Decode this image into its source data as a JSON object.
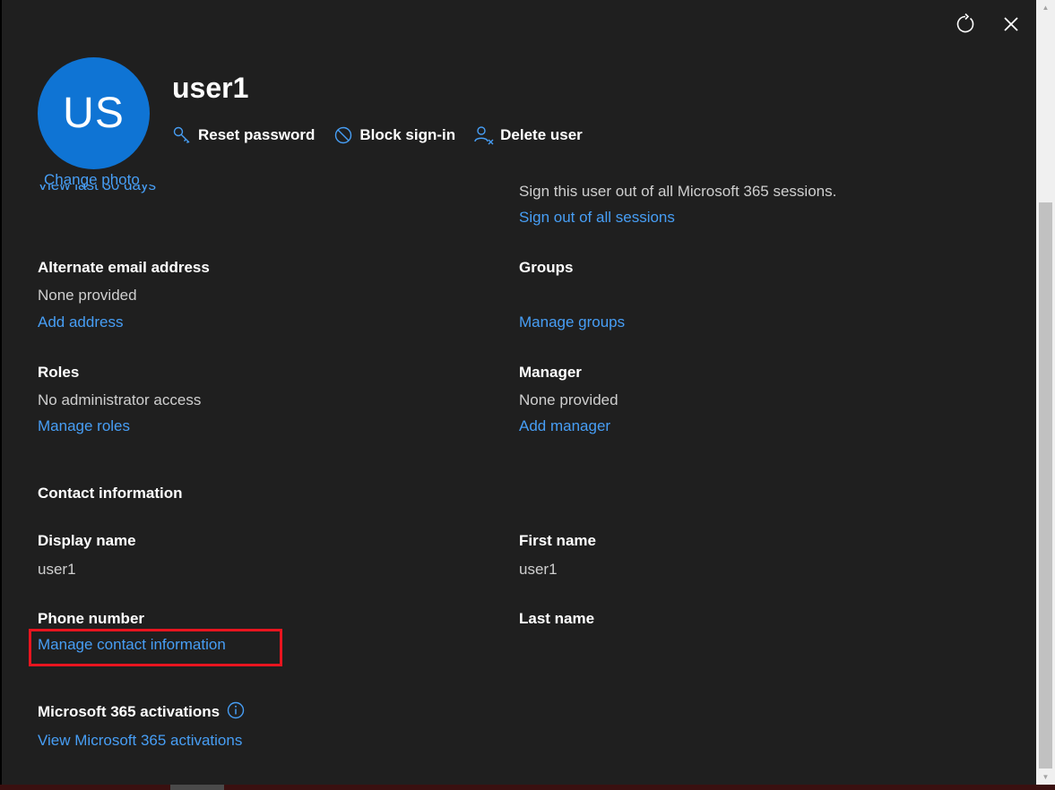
{
  "header": {
    "avatar_initials": "US",
    "change_photo_label": "Change photo",
    "user_name": "user1",
    "actions": {
      "reset_password": "Reset password",
      "block_sign_in": "Block sign-in",
      "delete_user": "Delete user"
    }
  },
  "partially_hidden": {
    "left_link": "View last 30 days",
    "right_text": "Sign this user out of all Microsoft 365 sessions."
  },
  "sign_out": {
    "link": "Sign out of all sessions"
  },
  "alternate_email": {
    "label": "Alternate email address",
    "value": "None provided",
    "link": "Add address"
  },
  "groups": {
    "label": "Groups",
    "link": "Manage groups"
  },
  "roles": {
    "label": "Roles",
    "value": "No administrator access",
    "link": "Manage roles"
  },
  "manager": {
    "label": "Manager",
    "value": "None provided",
    "link": "Add manager"
  },
  "contact": {
    "section_title": "Contact information",
    "display_name_label": "Display name",
    "display_name_value": "user1",
    "first_name_label": "First name",
    "first_name_value": "user1",
    "phone_label": "Phone number",
    "manage_contact_link": "Manage contact information",
    "last_name_label": "Last name"
  },
  "activations": {
    "label": "Microsoft 365 activations",
    "link": "View Microsoft 365 activations"
  },
  "icons": {
    "refresh": "refresh-icon",
    "close": "close-icon",
    "key": "key-icon",
    "block": "block-icon",
    "delete_user": "delete-user-icon",
    "info": "info-icon"
  },
  "colors": {
    "panel_bg": "#1f1f1f",
    "link": "#479ef5",
    "avatar": "#0f74d4",
    "highlight": "#e8151f"
  }
}
